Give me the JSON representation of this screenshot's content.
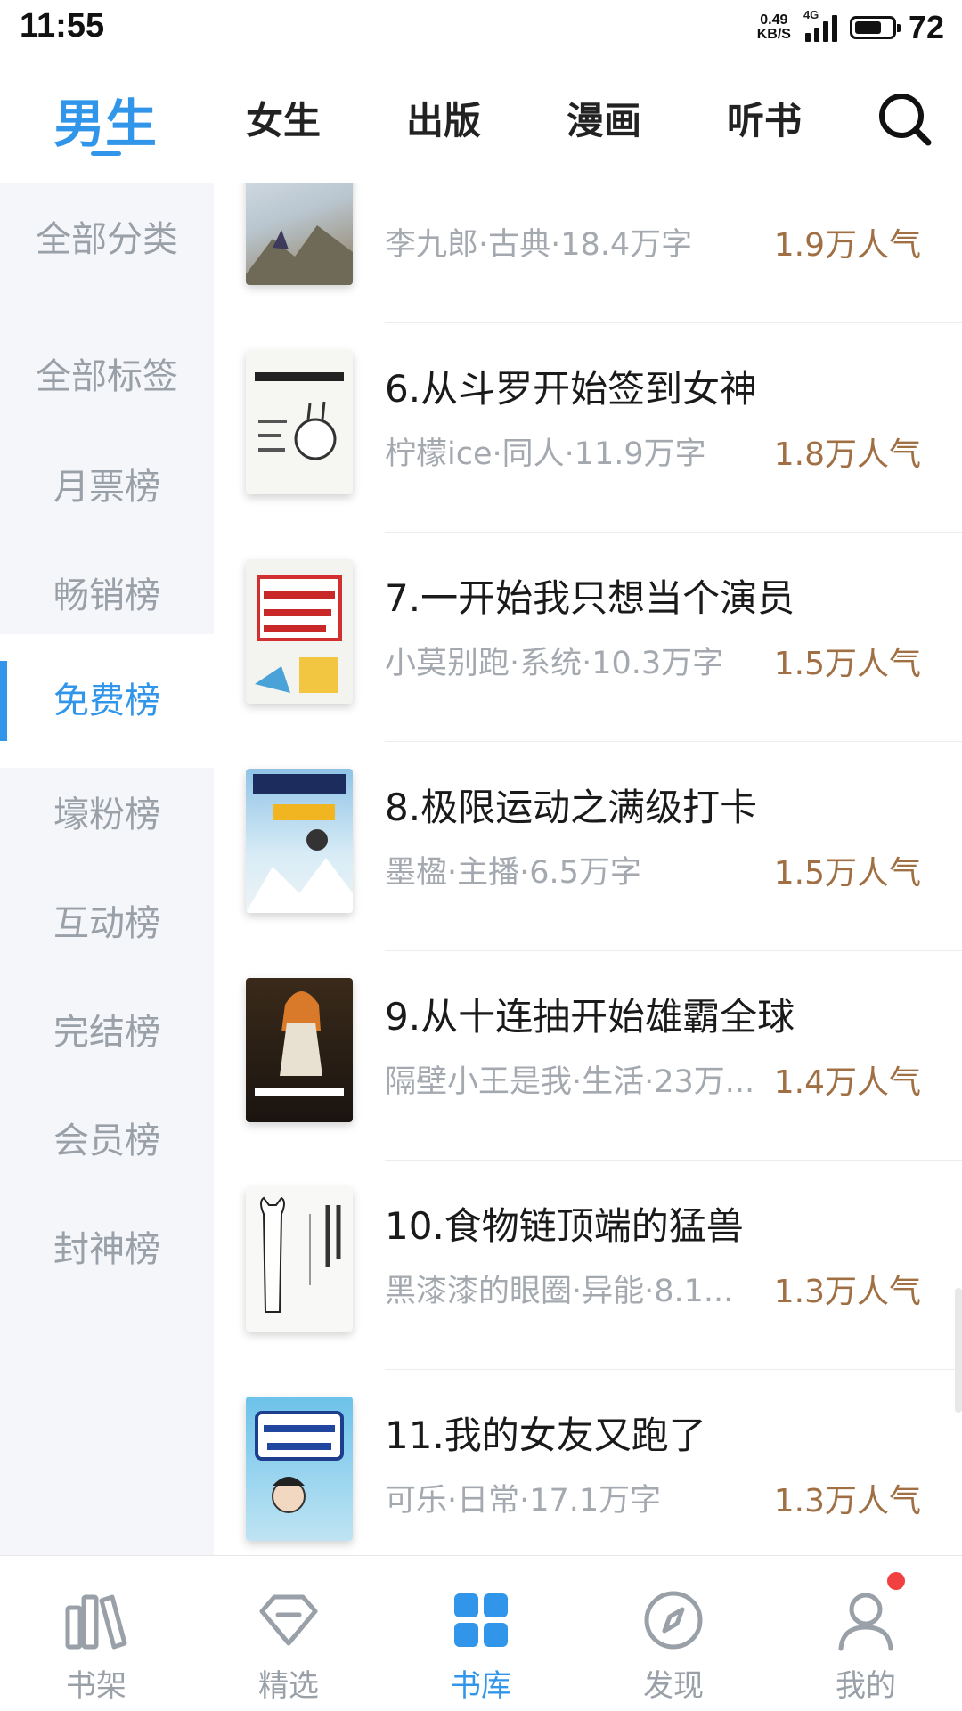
{
  "status_bar": {
    "time": "11:55",
    "net_speed_value": "0.49",
    "net_speed_unit": "KB/S",
    "network": "4G",
    "battery": "72"
  },
  "top_tabs": [
    {
      "label": "男生",
      "active": true
    },
    {
      "label": "女生",
      "active": false
    },
    {
      "label": "出版",
      "active": false
    },
    {
      "label": "漫画",
      "active": false
    },
    {
      "label": "听书",
      "active": false
    }
  ],
  "search_icon": "search-icon",
  "sidebar": [
    {
      "label": "全部分类"
    },
    {
      "label": "全部标签"
    },
    {
      "label": "月票榜"
    },
    {
      "label": "畅销榜"
    },
    {
      "label": "免费榜",
      "active": true
    },
    {
      "label": "壕粉榜"
    },
    {
      "label": "互动榜"
    },
    {
      "label": "完结榜"
    },
    {
      "label": "会员榜"
    },
    {
      "label": "封神榜"
    }
  ],
  "books": [
    {
      "title": "",
      "meta": "李九郎·古典·18.4万字",
      "popularity": "1.9万人气"
    },
    {
      "title": "6.从斗罗开始签到女神",
      "meta": "柠檬ice·同人·11.9万字",
      "popularity": "1.8万人气"
    },
    {
      "title": "7.一开始我只想当个演员",
      "meta": "小莫别跑·系统·10.3万字",
      "popularity": "1.5万人气"
    },
    {
      "title": "8.极限运动之满级打卡",
      "meta": "墨楹·主播·6.5万字",
      "popularity": "1.5万人气"
    },
    {
      "title": "9.从十连抽开始雄霸全球",
      "meta": "隔壁小王是我·生活·23万...",
      "popularity": "1.4万人气"
    },
    {
      "title": "10.食物链顶端的猛兽",
      "meta": "黑漆漆的眼圈·异能·8.1...",
      "popularity": "1.3万人气"
    },
    {
      "title": "11.我的女友又跑了",
      "meta": "可乐·日常·17.1万字",
      "popularity": "1.3万人气"
    }
  ],
  "bottom_nav": [
    {
      "label": "书架",
      "icon": "bookshelf-icon"
    },
    {
      "label": "精选",
      "icon": "diamond-icon"
    },
    {
      "label": "书库",
      "icon": "grid-icon",
      "active": true
    },
    {
      "label": "发现",
      "icon": "compass-icon"
    },
    {
      "label": "我的",
      "icon": "profile-icon",
      "badge": true
    }
  ],
  "colors": {
    "accent": "#3196e9",
    "popularity": "#a07044",
    "badge": "#f04040"
  }
}
